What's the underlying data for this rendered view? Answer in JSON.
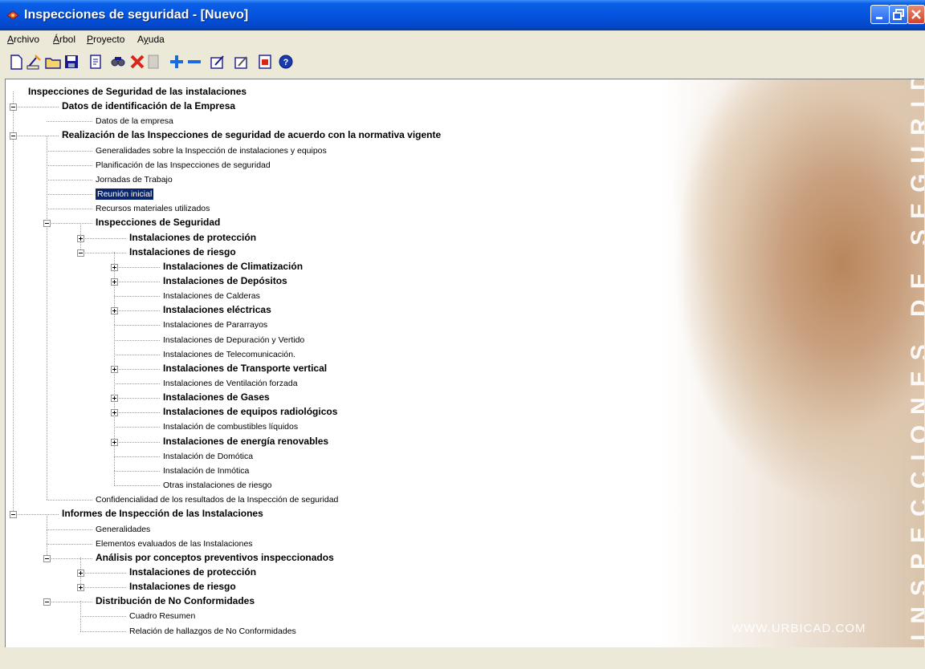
{
  "window": {
    "title": "Inspecciones de seguridad - [Nuevo]"
  },
  "menu": [
    {
      "label": "Archivo",
      "u": "A",
      "rest": "rchivo"
    },
    {
      "label": "Árbol",
      "u": "Á",
      "rest": "rbol"
    },
    {
      "label": "Proyecto",
      "u": "P",
      "rest": "royecto"
    },
    {
      "label": "Ayuda",
      "u": "y",
      "pre": "A",
      "rest": "uda"
    }
  ],
  "toolbar_icons": [
    "new-document-icon",
    "open-wizard-icon",
    "open-folder-icon",
    "save-icon",
    "preview-icon",
    "find-icon",
    "delete-icon",
    "disabled-icon",
    "add-icon",
    "remove-icon",
    "edit-icon",
    "edit-alt-icon",
    "report-icon",
    "help-icon"
  ],
  "colors": {
    "titlebar": "#0554df",
    "selection": "#0a246a",
    "face": "#ece9d8"
  },
  "tree": [
    "Inspecciones de Seguridad de las instalaciones",
    "Datos de identificación de la Empresa",
    "Datos de la empresa",
    "Realización de las Inspecciones de seguridad de acuerdo con la normativa vigente",
    "Generalidades sobre la Inspección de instalaciones y equipos",
    "Planificación de las Inspecciones de seguridad",
    "Jornadas de Trabajo",
    "Reunión inicial",
    "Recursos materiales utilizados",
    "Inspecciones de Seguridad",
    "Instalaciones de protección",
    "Instalaciones de riesgo",
    "Instalaciones de Climatización",
    "Instalaciones de Depósitos",
    "Instalaciones de Calderas",
    "Instalaciones eléctricas",
    "Instalaciones de Pararrayos",
    "Instalaciones de Depuración y Vertido",
    "Instalaciones de Telecomunicación.",
    "Instalaciones de Transporte vertical",
    "Instalaciones de Ventilación forzada",
    "Instalaciones de Gases",
    "Instalaciones de equipos radiológicos",
    "Instalación de combustibles líquidos",
    "Instalaciones de energía renovables",
    "Instalación de Domótica",
    "Instalación de Inmótica",
    "Otras instalaciones de riesgo",
    "Confidencialidad de los resultados de la Inspección de seguridad",
    "Informes de Inspección de las Instalaciones",
    "Generalidades",
    "Elementos evaluados de las Instalaciones",
    "Análisis por conceptos preventivos inspeccionados",
    "Instalaciones de protección",
    "Instalaciones de riesgo",
    "Distribución de No Conformidades",
    "Cuadro Resumen",
    "Relación de hallazgos de No Conformidades"
  ],
  "banner": {
    "vertical_title": "INSPECCIONES DE SEGURIDAD",
    "url": "WWW.URBICAD.COM"
  }
}
